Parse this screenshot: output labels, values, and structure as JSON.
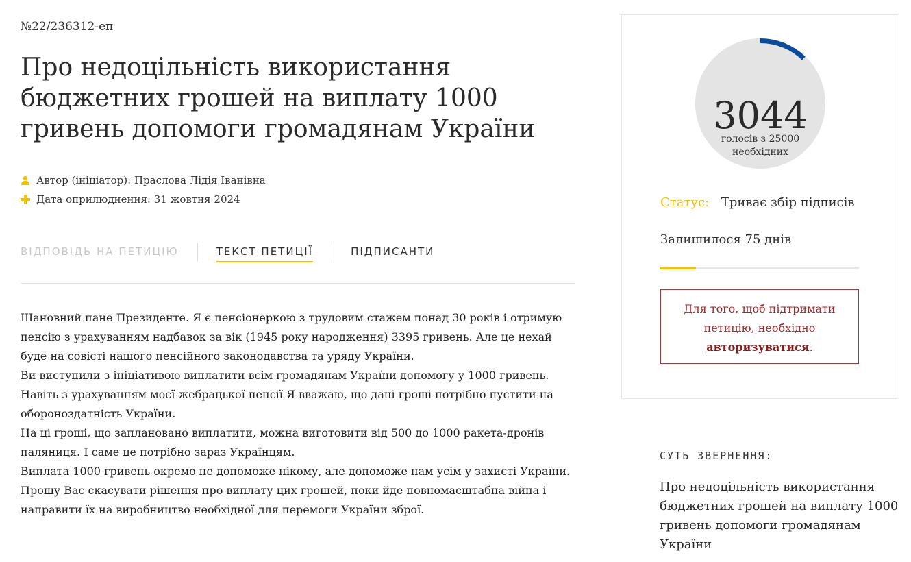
{
  "petition": {
    "number": "№22/236312-еп",
    "title": "Про недоцільність використання бюджетних грошей на виплату 1000 гривень допомоги громадянам України",
    "author": "Автор (ініціатор): Праслова Лідія Іванівна",
    "date": "Дата оприлюднення: 31 жовтня 2024"
  },
  "tabs": [
    {
      "label": "ВІДПОВІДЬ НА ПЕТИЦІЮ",
      "state": "disabled"
    },
    {
      "label": "ТЕКСТ ПЕТИЦІЇ",
      "state": "active"
    },
    {
      "label": "ПІДПИСАНТИ",
      "state": "normal"
    }
  ],
  "body_paragraphs": [
    "Шановний пане Президенте. Я є пенсіонеркою з трудовим стажем понад 30 років і отримую пенсію з урахуванням надбавок за вік (1945 року народження) 3395 гривень. Але це нехай буде на совісті нашого пенсійного законодавства та уряду України.",
    "Ви виступили з ініціативою виплатити всім громадянам України допомогу у 1000 гривень. Навіть з урахуванням моєї жебрацької пенсії Я вважаю, що дані гроші потрібно пустити на обороноздатність України.",
    "На ці гроші, що заплановано виплатити, можна виготовити від 500 до 1000 ракета-дронів паляниця. І саме це потрібно зараз Українцям.",
    "Виплата 1000 гривень окремо не допоможе нікому, але допоможе нам усім у захисті України.",
    "Прошу Вас скасувати рішення про виплату цих грошей, поки йде повномасштабна війна і направити їх на виробництво необхідної для перемоги України зброї."
  ],
  "votes": {
    "count": "3044",
    "subtitle": "голосів з 25000 необхідних",
    "collected": 3044,
    "required": 25000
  },
  "status": {
    "label": "Статус:",
    "value": "Триває збір підписів"
  },
  "remaining": {
    "text": "Залишилося 75 днів",
    "progress_fraction": 0.18
  },
  "auth": {
    "prefix": "Для того, щоб підтримати петицію, необхідно",
    "link": "авторизуватися",
    "suffix": "."
  },
  "essence": {
    "label": "СУТЬ ЗВЕРНЕННЯ:",
    "text": "Про недоцільність використання бюджетних грошей на виплату 1000 гривень допомоги громадянам України"
  },
  "colors": {
    "accent_yellow": "#f2c200",
    "progress_blue": "#0b4c9c",
    "alert_red": "#a82323",
    "circle_grey": "#e4e4e4"
  },
  "icons": {
    "author": "user-icon",
    "date": "plus-icon"
  }
}
